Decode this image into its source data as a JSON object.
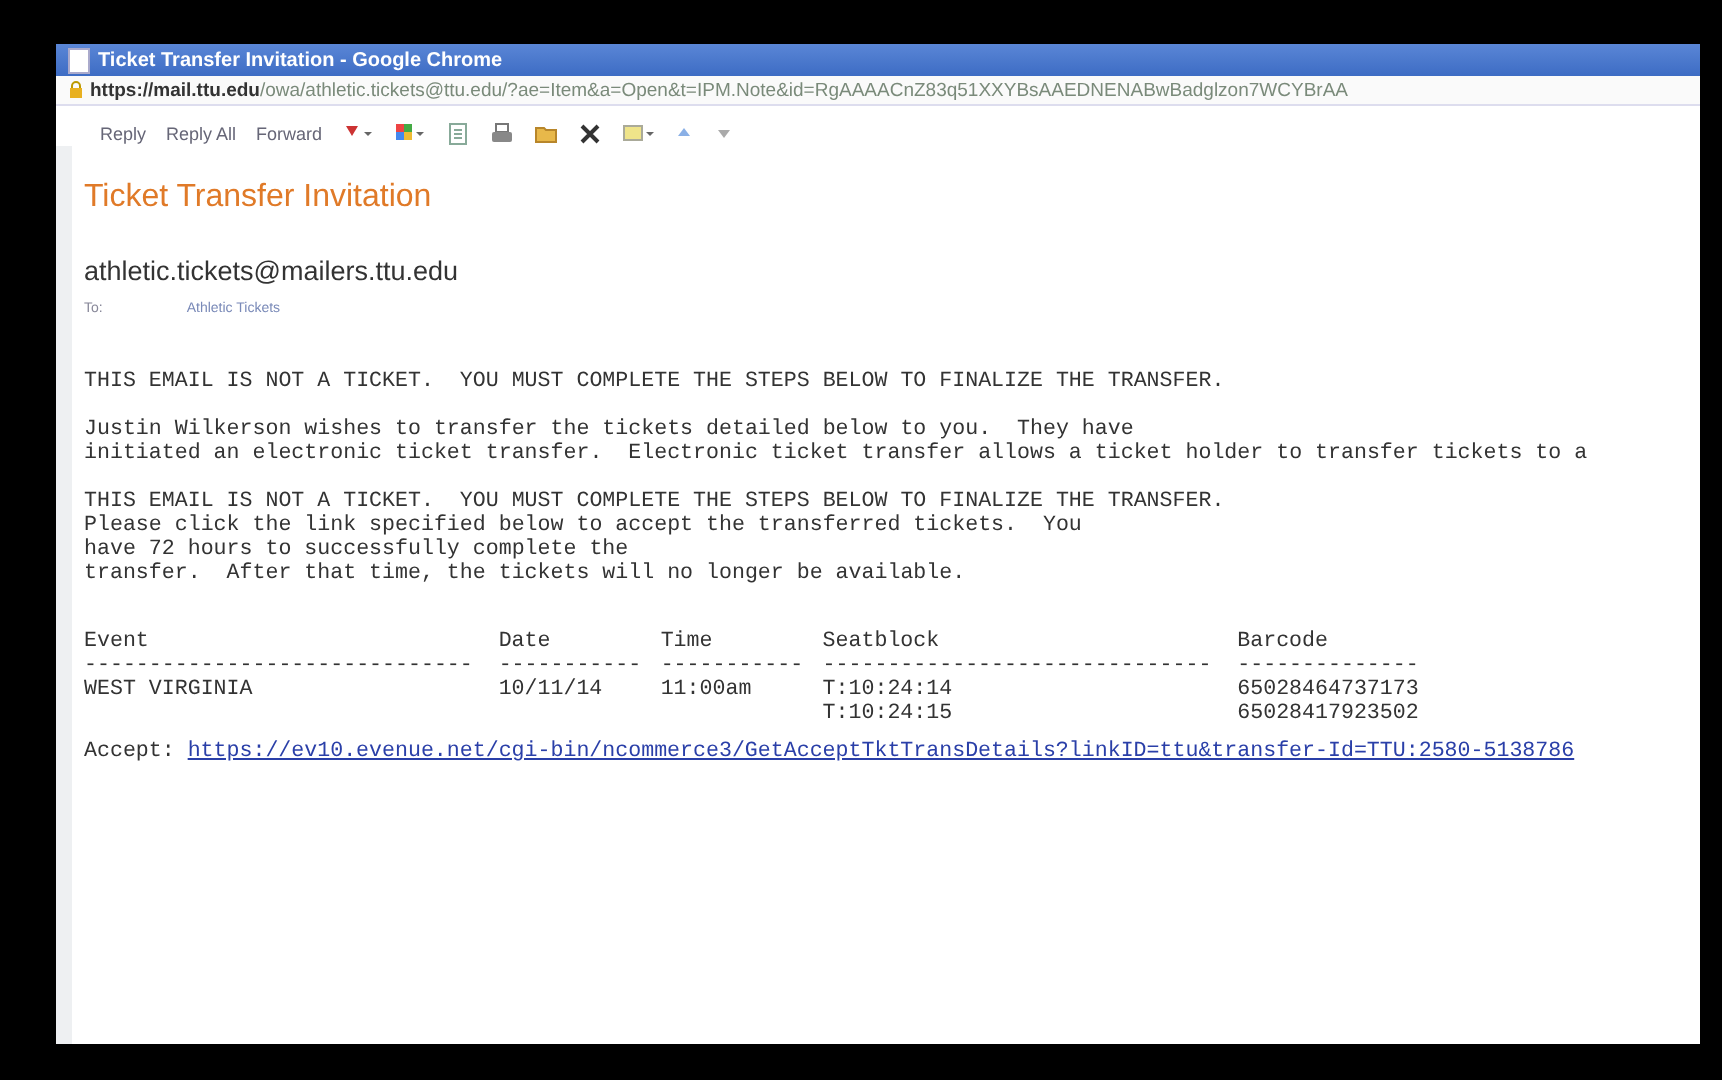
{
  "browser": {
    "title": "Ticket Transfer Invitation - Google Chrome",
    "url_host": "https://mail.ttu.edu",
    "url_path": "/owa/athletic.tickets@ttu.edu/?ae=Item&a=Open&t=IPM.Note&id=RgAAAACnZ83q51XXYBsAAEDNENABwBadglzon7WCYBrAA"
  },
  "toolbar": {
    "buttons": [
      "Reply",
      "Reply All",
      "Forward"
    ]
  },
  "message": {
    "subject": "Ticket Transfer Invitation",
    "sender": "athletic.tickets@mailers.ttu.edu",
    "to_label": "To:",
    "to": "Athletic Tickets"
  },
  "body": {
    "paragraphs": [
      [
        "THIS EMAIL IS NOT A TICKET.  YOU MUST COMPLETE THE STEPS BELOW TO FINALIZE THE TRANSFER."
      ],
      [
        "Justin Wilkerson wishes to transfer the tickets detailed below to you.  They have",
        "initiated an electronic ticket transfer.  Electronic ticket transfer allows a ticket holder to transfer tickets to a"
      ],
      [
        "THIS EMAIL IS NOT A TICKET.  YOU MUST COMPLETE THE STEPS BELOW TO FINALIZE THE TRANSFER.",
        "Please click the link specified below to accept the transferred tickets.  You",
        "have 72 hours to successfully complete the",
        "transfer.  After that time, the tickets will no longer be available."
      ]
    ]
  },
  "table": {
    "columns": [
      {
        "heading": "Event",
        "rule": "------------------------------"
      },
      {
        "heading": "Date",
        "rule": "-----------"
      },
      {
        "heading": "Time",
        "rule": "-----------"
      },
      {
        "heading": "Seatblock",
        "rule": "------------------------------"
      },
      {
        "heading": "Barcode",
        "rule": "--------------"
      }
    ],
    "rows": [
      {
        "event": "WEST VIRGINIA",
        "date": "10/11/14",
        "time": "11:00am",
        "seatblock": "T:10:24:14",
        "barcode": "65028464737173"
      },
      {
        "seatblock": "T:10:24:15",
        "barcode": "65028417923502"
      }
    ]
  },
  "accept": {
    "label": "Accept:",
    "link": "https://ev10.evenue.net/cgi-bin/ncommerce3/GetAcceptTktTransDetails?linkID=ttu&transfer-Id=TTU:2580-5138786"
  }
}
